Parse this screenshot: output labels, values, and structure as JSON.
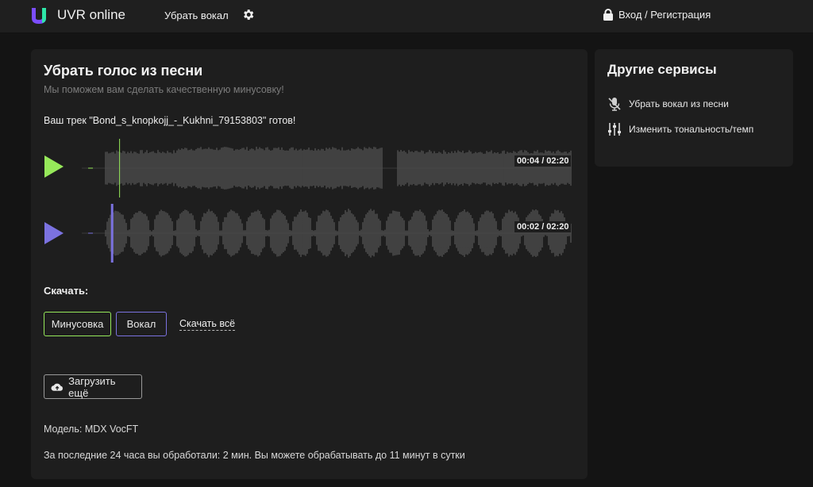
{
  "header": {
    "brand": "UVR online",
    "nav_remove_vocal": "Убрать вокал",
    "login": "Вход / Регистрация",
    "logo_color": "#7b4dff",
    "logo_accent": "#2ee6a8"
  },
  "main": {
    "title": "Убрать голос из песни",
    "subtitle": "Мы поможем вам сделать качественную минусовку!",
    "ready_text": "Ваш трек \"Bond_s_knopkojj_-_Kukhni_79153803\" готов!",
    "players": [
      {
        "name": "Минусовка",
        "time": "00:04 / 02:20",
        "color": "#96e85a",
        "progress": 0.03
      },
      {
        "name": "Вокал",
        "time": "00:02 / 02:20",
        "color": "#7b72e0",
        "progress": 0.014
      }
    ],
    "download_label": "Скачать:",
    "btn_minus": "Минусовка",
    "btn_vocal": "Вокал",
    "link_download_all": "Скачать всё",
    "btn_upload": "Загрузить ещё",
    "model": "Модель: MDX VocFT",
    "limits": "За последние 24 часа вы обработали: 2 мин. Вы можете обрабатывать до 11 минут в сутки"
  },
  "side": {
    "title": "Другие сервисы",
    "items": [
      {
        "label": "Убрать вокал из песни",
        "icon": "mic-off-icon"
      },
      {
        "label": "Изменить тональность/темп",
        "icon": "sliders-icon"
      }
    ]
  }
}
